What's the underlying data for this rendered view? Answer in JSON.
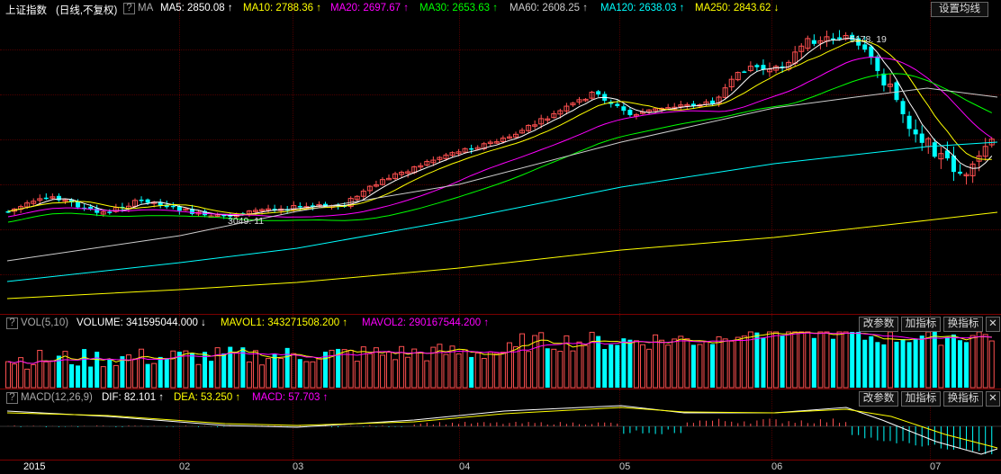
{
  "main": {
    "index_name": "上证指数",
    "period": "(日线,不复权)",
    "help": "?",
    "indicator": "MA",
    "ma": [
      {
        "label": "MA5: 2850.08",
        "arrow": "↑",
        "color": "#ffffff"
      },
      {
        "label": "MA10: 2788.36",
        "arrow": "↑",
        "color": "#ffff00"
      },
      {
        "label": "MA20: 2697.67",
        "arrow": "↑",
        "color": "#ff00ff"
      },
      {
        "label": "MA30: 2653.63",
        "arrow": "↑",
        "color": "#00ff00"
      },
      {
        "label": "MA60: 2608.25",
        "arrow": "↑",
        "color": "#cccccc"
      },
      {
        "label": "MA120: 2638.03",
        "arrow": "↑",
        "color": "#00ffff"
      },
      {
        "label": "MA250: 2843.62",
        "arrow": "↓",
        "color": "#ffff00"
      }
    ],
    "settings_button": "设置均线",
    "high_label": "5178. 19",
    "low_label": "3049. 11"
  },
  "vol": {
    "help": "?",
    "name": "VOL(5,10)",
    "volume": "VOLUME: 341595044.000",
    "volume_arrow": "↓",
    "mavol1": "MAVOL1: 343271508.200",
    "mavol1_arrow": "↑",
    "mavol2": "MAVOL2: 290167544.200",
    "mavol2_arrow": "↑"
  },
  "macd": {
    "help": "?",
    "name": "MACD(12,26,9)",
    "dif": "DIF: 82.101",
    "dif_arrow": "↑",
    "dea": "DEA: 53.250",
    "dea_arrow": "↑",
    "macd": "MACD: 57.703",
    "macd_arrow": "↑"
  },
  "panel_buttons": {
    "modify": "改参数",
    "add": "加指标",
    "switch": "换指标",
    "close": "✕"
  },
  "xaxis": {
    "year": "2015",
    "months": [
      "02",
      "03",
      "04",
      "05",
      "06",
      "07"
    ]
  },
  "colors": {
    "up": "#ff5050",
    "down": "#00ffff",
    "ma5": "#ffffff",
    "ma10": "#ffff00",
    "ma20": "#ff00ff",
    "ma30": "#00ff00",
    "ma60": "#cccccc",
    "ma120": "#00ffff",
    "ma250": "#ffff00"
  }
}
